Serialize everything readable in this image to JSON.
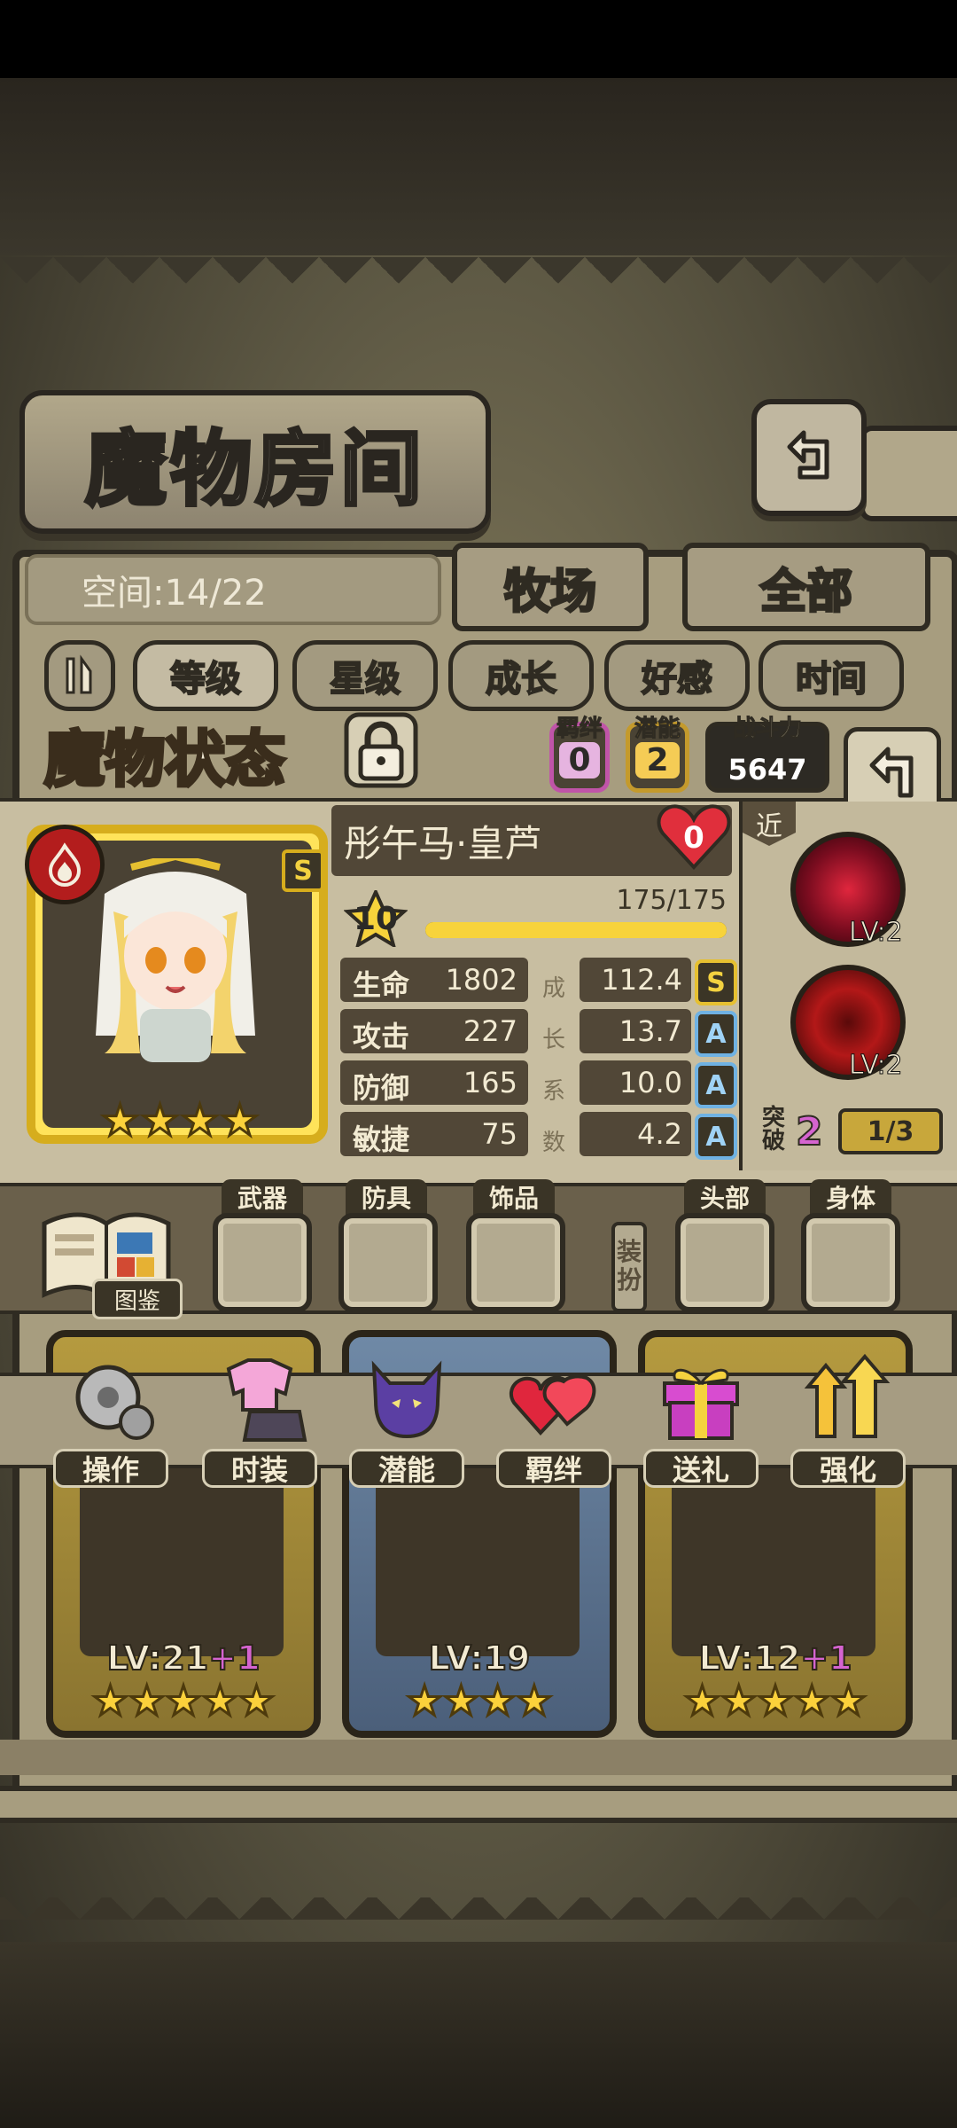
{
  "header": {
    "title": "魔物房间"
  },
  "room": {
    "space_label": "空间:14/22",
    "tabs": [
      "牧场",
      "全部"
    ]
  },
  "sort": {
    "buttons": [
      "等级",
      "星级",
      "成长",
      "好感",
      "时间"
    ]
  },
  "status": {
    "title": "魔物状态",
    "bond_label": "羁绊",
    "bond_value": "0",
    "potential_label": "潜能",
    "potential_value": "2",
    "power_label": "战斗力",
    "power_value": "5647"
  },
  "monster": {
    "name": "彤午马·皇芦",
    "affection": "0",
    "rank": "S",
    "stars": 4,
    "level": "10",
    "exp_text": "175/175",
    "exp_fraction": 1.0,
    "stats": [
      {
        "label": "生命",
        "value": "1802",
        "growth": "112.4",
        "grade": "S"
      },
      {
        "label": "攻击",
        "value": "227",
        "growth": "13.7",
        "grade": "A"
      },
      {
        "label": "防御",
        "value": "165",
        "growth": "10.0",
        "grade": "A"
      },
      {
        "label": "敏捷",
        "value": "75",
        "growth": "4.2",
        "grade": "A"
      }
    ],
    "growth_caption": [
      "成",
      "长",
      "系",
      "数"
    ]
  },
  "skills": {
    "range_tag": "近",
    "list": [
      {
        "lv": "LV:2"
      },
      {
        "lv": "LV:2"
      }
    ],
    "breakthrough_label": "突破",
    "breakthrough_value": "2",
    "breakthrough_progress": "1/3"
  },
  "equipment": {
    "book_label": "图鉴",
    "equip_label": "装扮",
    "slots": [
      "武器",
      "防具",
      "饰品",
      "头部",
      "身体"
    ]
  },
  "actions": [
    "操作",
    "时装",
    "潜能",
    "羁绊",
    "送礼",
    "强化"
  ],
  "cards": [
    {
      "lv": "LV:21",
      "plus": "+1",
      "stars": 5,
      "frame": "gold"
    },
    {
      "lv": "LV:19",
      "plus": "",
      "stars": 4,
      "frame": "blue"
    },
    {
      "lv": "LV:12",
      "plus": "+1",
      "stars": 5,
      "frame": "gold"
    }
  ],
  "colors": {
    "gold": "#d6ad1d",
    "panel": "#c8bea1",
    "dark": "#2f2b22",
    "pink": "#d564d0"
  }
}
